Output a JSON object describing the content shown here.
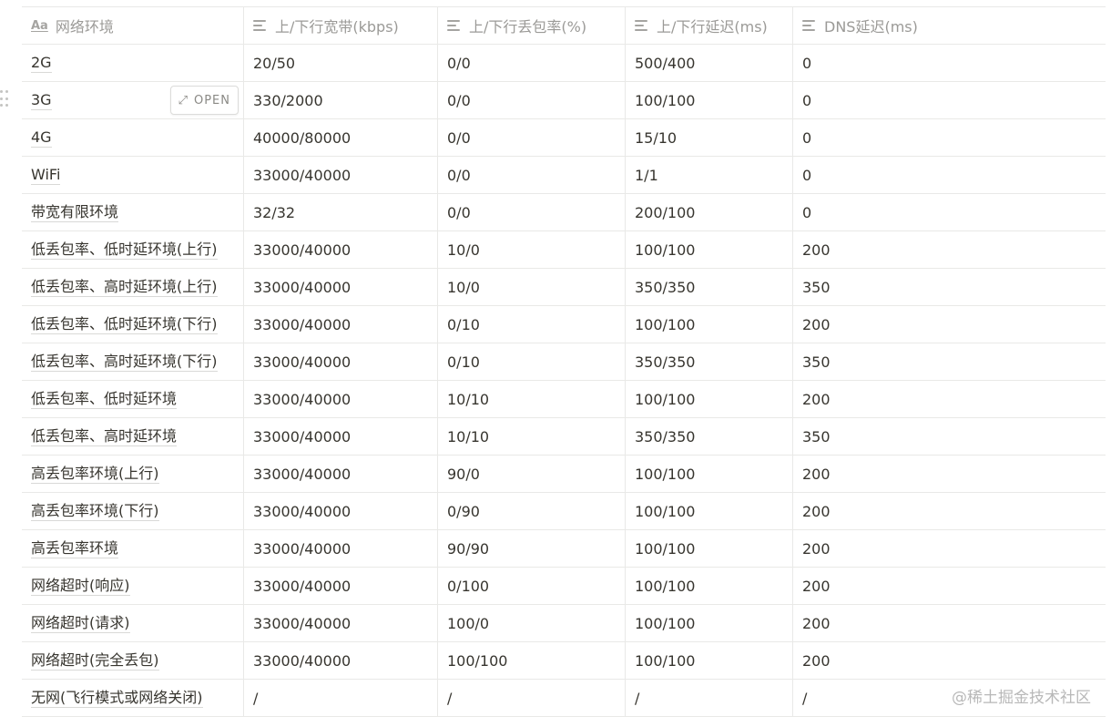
{
  "table": {
    "headers": [
      {
        "label": "网络环境",
        "icon": "title-property-icon"
      },
      {
        "label": "上/下行宽带(kbps)",
        "icon": "text-property-icon"
      },
      {
        "label": "上/下行丢包率(%)",
        "icon": "text-property-icon"
      },
      {
        "label": "上/下行延迟(ms)",
        "icon": "text-property-icon"
      },
      {
        "label": "DNS延迟(ms)",
        "icon": "text-property-icon"
      }
    ],
    "rows": [
      [
        "2G",
        "20/50",
        "0/0",
        "500/400",
        "0"
      ],
      [
        "3G",
        "330/2000",
        "0/0",
        "100/100",
        "0"
      ],
      [
        "4G",
        "40000/80000",
        "0/0",
        "15/10",
        "0"
      ],
      [
        "WiFi",
        "33000/40000",
        "0/0",
        "1/1",
        "0"
      ],
      [
        "带宽有限环境",
        "32/32",
        "0/0",
        "200/100",
        "0"
      ],
      [
        "低丢包率、低时延环境(上行)",
        "33000/40000",
        "10/0",
        "100/100",
        "200"
      ],
      [
        "低丢包率、高时延环境(上行)",
        "33000/40000",
        "10/0",
        "350/350",
        "350"
      ],
      [
        "低丢包率、低时延环境(下行)",
        "33000/40000",
        "0/10",
        "100/100",
        "200"
      ],
      [
        "低丢包率、高时延环境(下行)",
        "33000/40000",
        "0/10",
        "350/350",
        "350"
      ],
      [
        "低丢包率、低时延环境",
        "33000/40000",
        "10/10",
        "100/100",
        "200"
      ],
      [
        "低丢包率、高时延环境",
        "33000/40000",
        "10/10",
        "350/350",
        "350"
      ],
      [
        "高丢包率环境(上行)",
        "33000/40000",
        "90/0",
        "100/100",
        "200"
      ],
      [
        "高丢包率环境(下行)",
        "33000/40000",
        "0/90",
        "100/100",
        "200"
      ],
      [
        "高丢包率环境",
        "33000/40000",
        "90/90",
        "100/100",
        "200"
      ],
      [
        "网络超时(响应)",
        "33000/40000",
        "0/100",
        "100/100",
        "200"
      ],
      [
        "网络超时(请求)",
        "33000/40000",
        "100/0",
        "100/100",
        "200"
      ],
      [
        "网络超时(完全丢包)",
        "33000/40000",
        "100/100",
        "100/100",
        "200"
      ],
      [
        "无网(飞行模式或网络关闭)",
        "/",
        "/",
        "/",
        "/"
      ]
    ]
  },
  "open_button": {
    "label": "OPEN",
    "icon": "expand-icon"
  },
  "watermark": "@稀土掘金技术社区"
}
